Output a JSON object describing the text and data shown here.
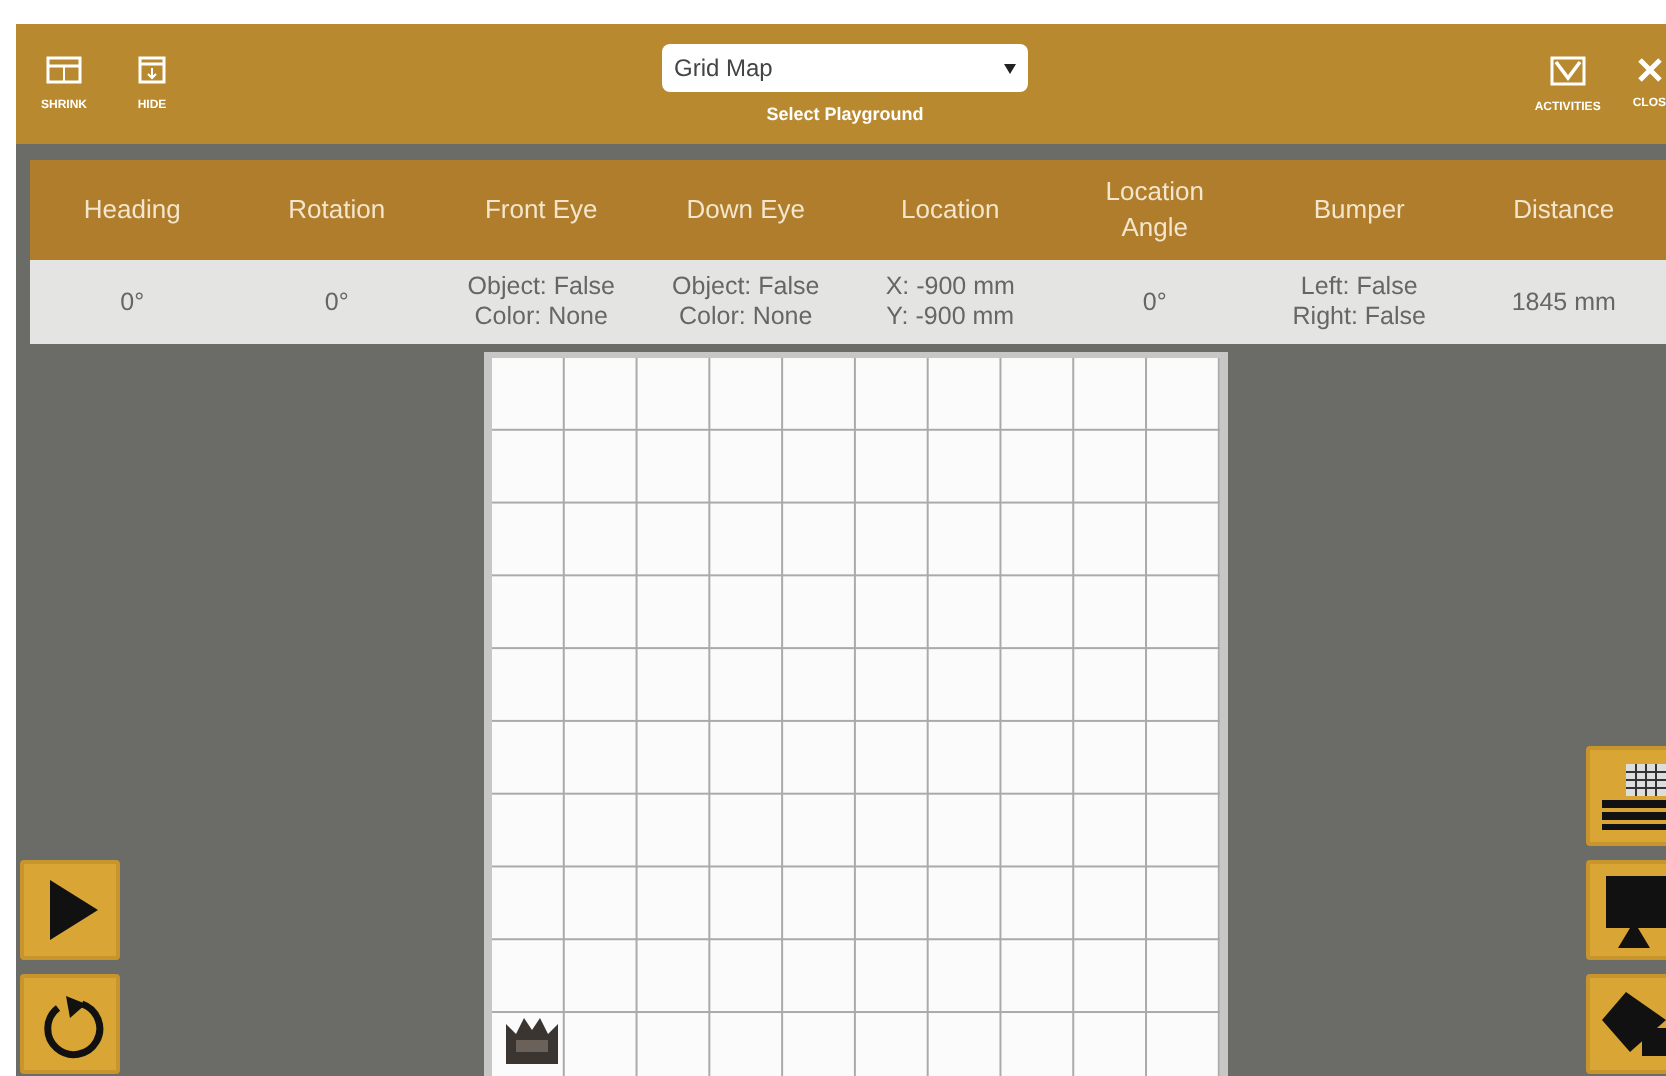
{
  "toolbar": {
    "left_buttons": [
      {
        "label": "SHRINK"
      },
      {
        "label": "HIDE"
      }
    ],
    "playground_select": {
      "value": "Grid Map",
      "caption": "Select Playground"
    },
    "right_buttons": [
      {
        "label": "ACTIVITIES"
      },
      {
        "label": "CLOS"
      }
    ]
  },
  "sensor_table": {
    "columns": [
      "Heading",
      "Rotation",
      "Front Eye",
      "Down Eye",
      "Location",
      "Location Angle",
      "Bumper",
      "Distance"
    ],
    "row": [
      "0°",
      "0°",
      "Object: False\nColor: None",
      "Object: False\nColor: None",
      "X: -900 mm\nY: -900 mm",
      "0°",
      "Left: False\nRight: False",
      "1845 mm"
    ]
  }
}
